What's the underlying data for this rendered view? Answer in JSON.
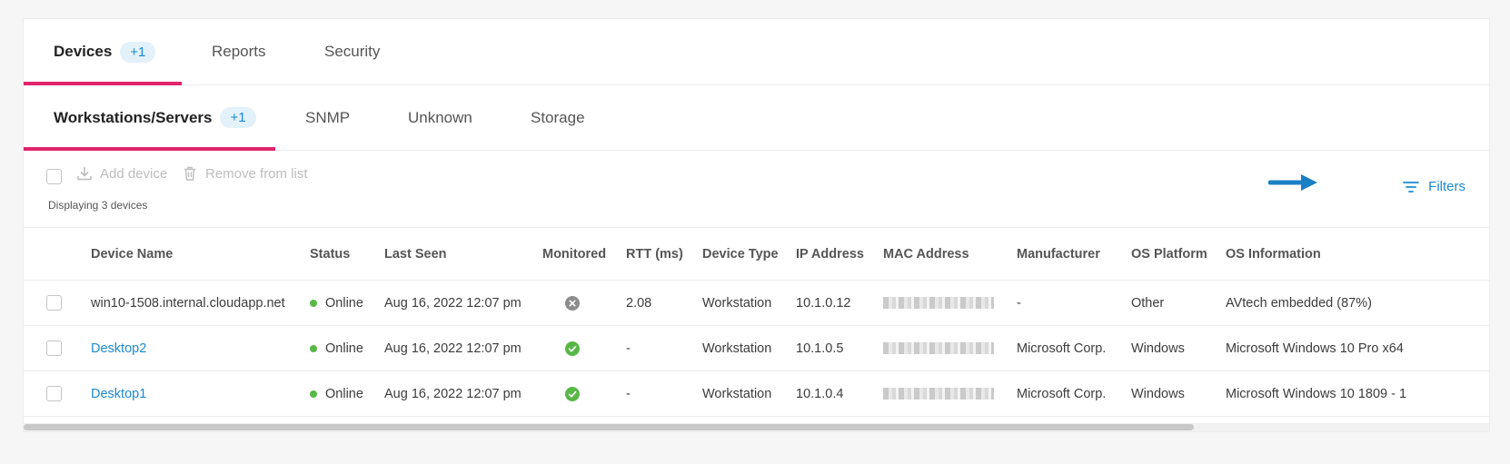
{
  "tabs": [
    {
      "label": "Devices",
      "badge": "+1",
      "active": true
    },
    {
      "label": "Reports"
    },
    {
      "label": "Security"
    }
  ],
  "subtabs": [
    {
      "label": "Workstations/Servers",
      "badge": "+1",
      "active": true
    },
    {
      "label": "SNMP"
    },
    {
      "label": "Unknown"
    },
    {
      "label": "Storage"
    }
  ],
  "toolbar": {
    "add_device": "Add device",
    "remove_from_list": "Remove from list",
    "displaying": "Displaying 3 devices",
    "filters": "Filters"
  },
  "colors": {
    "accent": "#e0246c",
    "link": "#1a8ad2",
    "online": "#58b847"
  },
  "table": {
    "headers": [
      "Device Name",
      "Status",
      "Last Seen",
      "Monitored",
      "RTT (ms)",
      "Device Type",
      "IP Address",
      "MAC Address",
      "Manufacturer",
      "OS Platform",
      "OS Information"
    ],
    "rows": [
      {
        "name": "win10-1508.internal.cloudapp.net",
        "status": "Online",
        "last_seen": "Aug 16, 2022 12:07 pm",
        "monitored": "x-circle-icon",
        "rtt": "2.08",
        "type": "Workstation",
        "ip": "10.1.0.12",
        "manufacturer": "-",
        "platform": "Other",
        "os_info": "AVtech embedded (87%)"
      },
      {
        "name": "Desktop2",
        "status": "Online",
        "last_seen": "Aug 16, 2022 12:07 pm",
        "monitored": "check-circle-icon",
        "rtt": "-",
        "type": "Workstation",
        "ip": "10.1.0.5",
        "manufacturer": "Microsoft Corp.",
        "platform": "Windows",
        "os_info": "Microsoft Windows 10 Pro x64"
      },
      {
        "name": "Desktop1",
        "status": "Online",
        "last_seen": "Aug 16, 2022 12:07 pm",
        "monitored": "check-circle-icon",
        "rtt": "-",
        "type": "Workstation",
        "ip": "10.1.0.4",
        "manufacturer": "Microsoft Corp.",
        "platform": "Windows",
        "os_info": "Microsoft Windows 10 1809 - 1"
      }
    ]
  }
}
